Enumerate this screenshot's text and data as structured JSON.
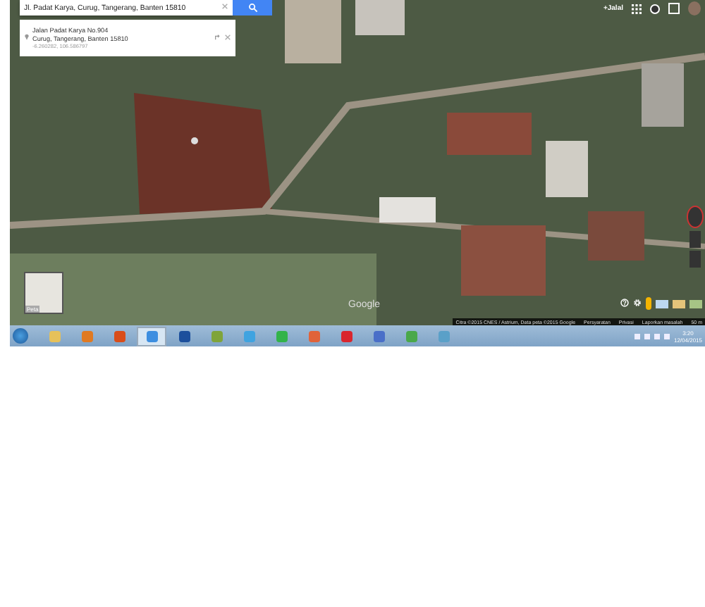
{
  "search": {
    "value": "Jl. Padat Karya, Curug, Tangerang, Banten 15810"
  },
  "place_card": {
    "title": "Jalan Padat Karya No.904",
    "address": "Curug, Tangerang, Banten 15810",
    "coordinates": "-6.260282, 106.586797"
  },
  "account": {
    "name": "+Jalal"
  },
  "layer_thumbnail": {
    "label": "Peta"
  },
  "logo": "Google",
  "attribution": [
    "Citra ©2015 CNES / Astrium, Data peta ©2015 Google",
    "Persyaratan",
    "Privasi",
    "Laporkan masalah",
    "50 m"
  ],
  "taskbar_buttons": [
    {
      "selected": false
    },
    {
      "selected": false
    },
    {
      "selected": false
    },
    {
      "selected": true
    },
    {
      "selected": false
    },
    {
      "selected": false
    },
    {
      "selected": false
    },
    {
      "selected": false
    },
    {
      "selected": false
    },
    {
      "selected": false
    },
    {
      "selected": false
    },
    {
      "selected": false
    },
    {
      "selected": false
    }
  ],
  "clock": {
    "time": "3:20",
    "date": "12/04/2015"
  }
}
